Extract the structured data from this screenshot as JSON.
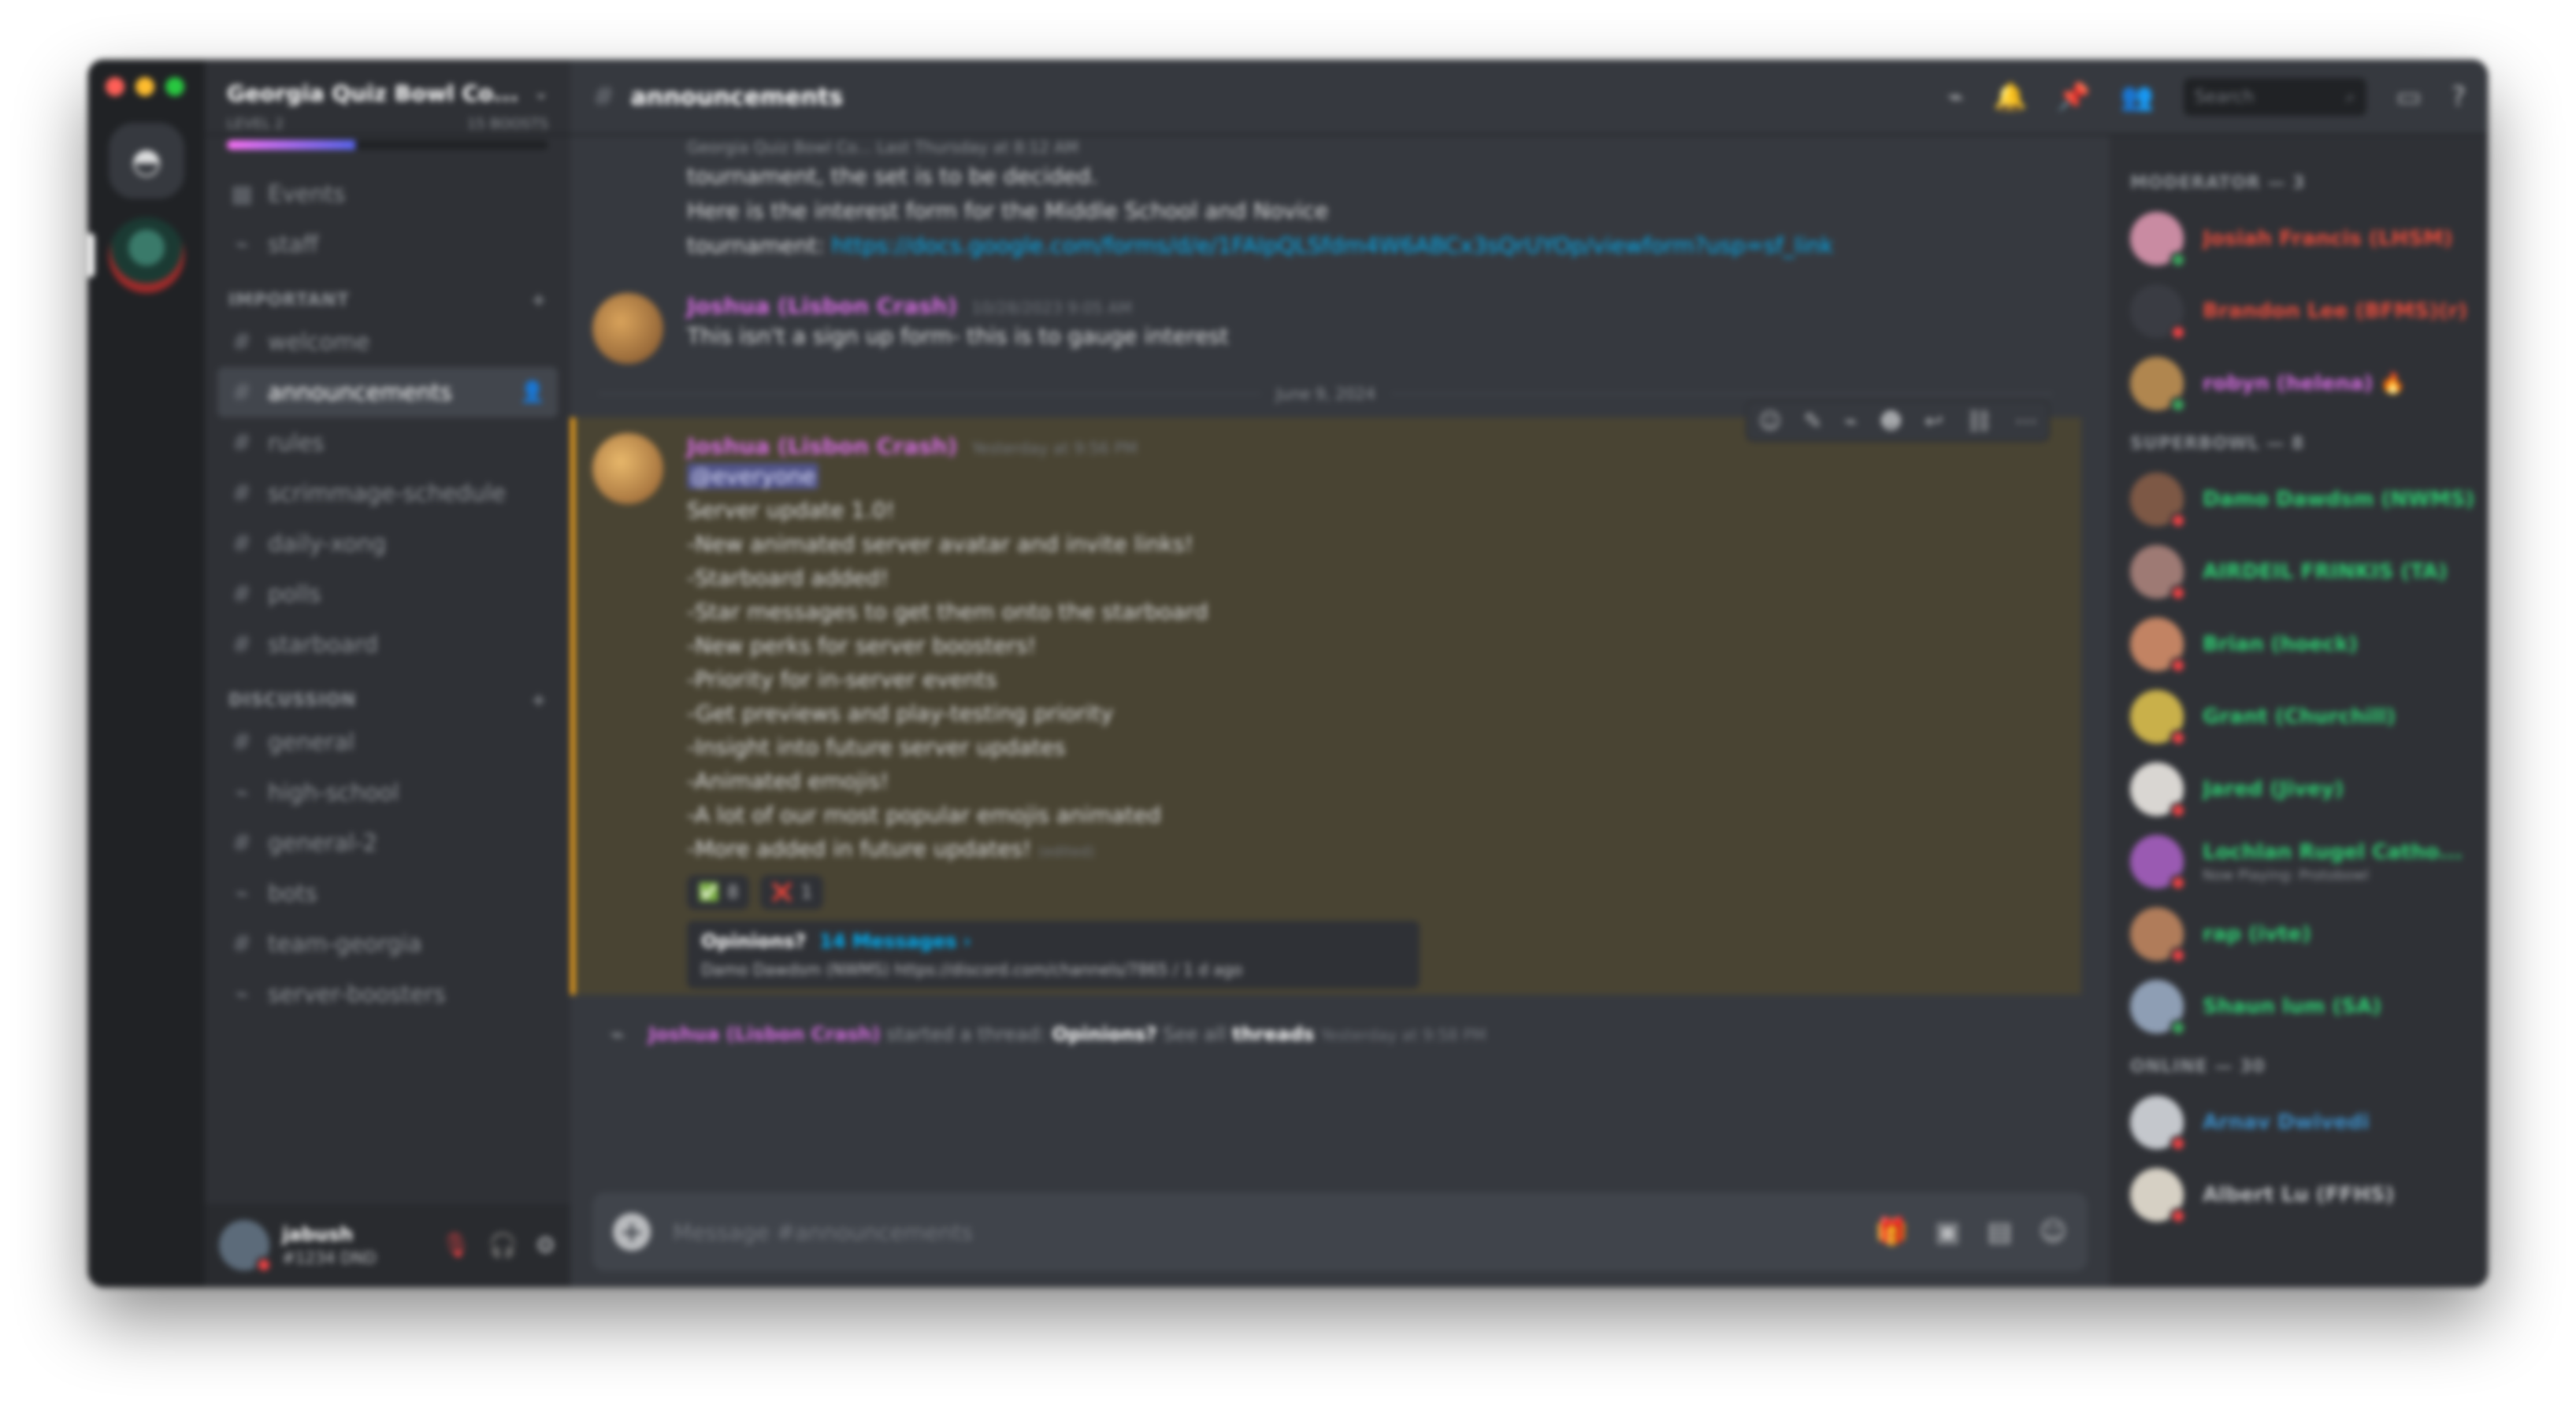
{
  "colors": {
    "online": "#3ba55d",
    "dnd": "#ed4245",
    "idle": "#faa81a",
    "role_pink": "#d36bde",
    "role_green": "#2ecc71",
    "role_red": "#e74c3c"
  },
  "window": {
    "lights": [
      "#ff5f57",
      "#febc2e",
      "#28c840"
    ]
  },
  "server": {
    "name": "Georgia Quiz Bowl Co...",
    "subtitle_left": "LEVEL 2",
    "subtitle_right": "15 BOOSTS",
    "boost_progress": 0.4
  },
  "rail": {
    "home_icon": "discord-logo-icon"
  },
  "channels": {
    "top": [
      {
        "label": "Events",
        "icon": "calendar-icon",
        "glyph": "▦"
      },
      {
        "label": "staff",
        "icon": "thread-icon",
        "glyph": "⌁"
      }
    ],
    "category1": "IMPORTANT",
    "important": [
      {
        "label": "welcome",
        "glyph": "#"
      },
      {
        "label": "announcements",
        "glyph": "#",
        "active": true
      },
      {
        "label": "rules",
        "glyph": "#"
      },
      {
        "label": "scrimmage-schedule",
        "glyph": "#"
      },
      {
        "label": "daily-xong",
        "glyph": "#"
      },
      {
        "label": "polls",
        "glyph": "#"
      },
      {
        "label": "starboard",
        "glyph": "#"
      }
    ],
    "category2": "DISCUSSION",
    "discussion": [
      {
        "label": "general",
        "glyph": "#"
      },
      {
        "label": "high-school",
        "glyph": "⌁"
      },
      {
        "label": "general-2",
        "glyph": "#"
      },
      {
        "label": "bots",
        "glyph": "⌁"
      },
      {
        "label": "team-georgia",
        "glyph": "#"
      },
      {
        "label": "server-boosters",
        "glyph": "⌁"
      }
    ]
  },
  "user": {
    "name": "jabush",
    "tag": "#1234 DND"
  },
  "topbar": {
    "channel": "announcements",
    "search_placeholder": "Search"
  },
  "messages": {
    "prev_small": "Georgia Quiz Bowl Co... Last Thursday at 8:12 AM",
    "prev_lines": [
      "tournament, the set is to be decided.",
      "Here is the interest form for the Middle School and Novice",
      "tournament: "
    ],
    "prev_link": "https://docs.google.com/forms/d/e/1FAIpQLSfdm4W6ABCx3sQrUYOp/viewform?usp=sf_link",
    "msg1": {
      "author": "Joshua (Lisbon Crash)",
      "time": "10/28/2023 9:05 AM",
      "text": "This isn't a sign up form- this is to gauge interest"
    },
    "divider": "June 9, 2024",
    "msg2": {
      "author": "Joshua (Lisbon Crash)",
      "time": "Yesterday at 9:56 PM",
      "mention": "@everyone",
      "lines": [
        "Server update 1.0!",
        "-New animated server avatar and invite links!",
        "-Starboard added!",
        "  -Star messages to get them onto the starboard",
        "-New perks for server boosters!",
        "  -Priority for in-server events",
        "  -Get previews and play-testing priority",
        "  -Insight into future server updates",
        "-Animated emojis!",
        "  -A lot of our most popular emojis animated",
        "-More added in future updates!"
      ],
      "edited": "(edited)",
      "reactions": [
        {
          "emoji": "✅",
          "count": "8",
          "color": "#3ba55d"
        },
        {
          "emoji": "❌",
          "count": "1",
          "color": "#ed4245"
        }
      ],
      "thread": {
        "title": "Opinions?",
        "count": "14 Messages ›",
        "last": "Damo Dawdsm (NWMS)  https://discord.com/channels/7865 / 1 d ago"
      }
    },
    "system": {
      "author": "Joshua (Lisbon Crash)",
      "prefix": "started a thread:",
      "thread": "Opinions?",
      "mid": "See all",
      "threads": "threads",
      "time": "Yesterday at 9:58 PM"
    }
  },
  "composer": {
    "placeholder": "Message #announcements"
  },
  "members": {
    "role1": "MODERATOR — 3",
    "group1": [
      {
        "name": "Josiah Francis (LHSM)",
        "color": "#e74c3c",
        "status": "#3ba55d",
        "av": "#c98ba2"
      },
      {
        "name": "Brandon Lee (BFMS)(r)",
        "color": "#e74c3c",
        "status": "#ed4245",
        "av": "#3a3c43"
      },
      {
        "name": "robyn (helena) 🔥",
        "color": "#d36bde",
        "status": "#3ba55d",
        "av": "#b0864f"
      }
    ],
    "role2": "SUPERBOWL — 8",
    "group2": [
      {
        "name": "Damo Dawdsm (NWMS)",
        "color": "#2ecc71",
        "status": "#ed4245",
        "av": "#7d5845"
      },
      {
        "name": "AIRDEIL FRINKIS (TA)",
        "color": "#2ecc71",
        "status": "#ed4245",
        "av": "#9e7a74"
      },
      {
        "name": "Brian (hoeck)",
        "color": "#2ecc71",
        "status": "#ed4245",
        "av": "#c28363"
      },
      {
        "name": "Grant (Churchill)",
        "color": "#2ecc71",
        "status": "#ed4245",
        "av": "#c9b04a"
      },
      {
        "name": "Jared (Jivey)",
        "color": "#2ecc71",
        "status": "#ed4245",
        "av": "#d9d6d2"
      },
      {
        "name": "Lochlan Rugel Catho...",
        "color": "#2ecc71",
        "status": "#ed4245",
        "av": "#9a5ab2",
        "sub": "Now Playing: Protobowl"
      },
      {
        "name": "rap (ivte)",
        "color": "#2ecc71",
        "status": "#ed4245",
        "av": "#b07c5a"
      },
      {
        "name": "Shaun lum (SA)",
        "color": "#2ecc71",
        "status": "#3ba55d",
        "av": "#8e9eb4"
      }
    ],
    "role3": "ONLINE — 30",
    "group3": [
      {
        "name": "Arnav Dwivedi",
        "color": "#3b8cc5",
        "status": "#ed4245",
        "av": "#c4c7cc"
      },
      {
        "name": "Albert Lu (FFHS)",
        "color": "#b9bbbe",
        "status": "#ed4245",
        "av": "#d6d0c4"
      }
    ]
  }
}
